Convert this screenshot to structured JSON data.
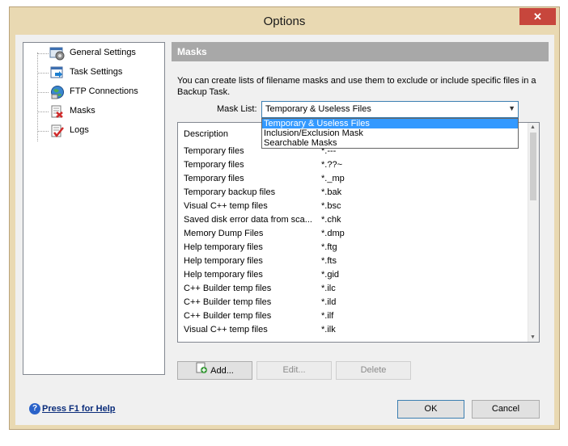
{
  "window": {
    "title": "Options",
    "close_label": "✕"
  },
  "tree": {
    "items": [
      {
        "label": "General Settings",
        "icon": "gear-icon"
      },
      {
        "label": "Task Settings",
        "icon": "task-icon"
      },
      {
        "label": "FTP Connections",
        "icon": "globe-icon"
      },
      {
        "label": "Masks",
        "icon": "masks-icon"
      },
      {
        "label": "Logs",
        "icon": "logs-icon"
      }
    ]
  },
  "panel": {
    "header": "Masks",
    "description": "You can create lists of filename masks and use them to exclude or include specific files in a Backup Task.",
    "mask_list_label": "Mask List:",
    "mask_list_value": "Temporary & Useless Files",
    "dropdown_options": [
      "Temporary & Useless Files",
      "Inclusion/Exclusion Mask",
      "Searchable Masks"
    ],
    "columns": {
      "description": "Description",
      "mask": ""
    },
    "rows": [
      {
        "description": "Temporary files",
        "mask": "*.---"
      },
      {
        "description": "Temporary files",
        "mask": "*.??~"
      },
      {
        "description": "Temporary files",
        "mask": "*._mp"
      },
      {
        "description": "Temporary backup files",
        "mask": "*.bak"
      },
      {
        "description": "Visual C++ temp files",
        "mask": "*.bsc"
      },
      {
        "description": "Saved disk error data from sca...",
        "mask": "*.chk"
      },
      {
        "description": "Memory Dump Files",
        "mask": "*.dmp"
      },
      {
        "description": "Help temporary files",
        "mask": "*.ftg"
      },
      {
        "description": "Help temporary files",
        "mask": "*.fts"
      },
      {
        "description": "Help temporary files",
        "mask": "*.gid"
      },
      {
        "description": "C++ Builder temp files",
        "mask": "*.ilc"
      },
      {
        "description": "C++ Builder temp files",
        "mask": "*.ild"
      },
      {
        "description": "C++ Builder temp files",
        "mask": "*.ilf"
      },
      {
        "description": "Visual C++ temp files",
        "mask": "*.ilk"
      }
    ],
    "buttons": {
      "add": "Add...",
      "edit": "Edit...",
      "delete": "Delete"
    }
  },
  "footer": {
    "help_label": "Press F1 for Help",
    "ok": "OK",
    "cancel": "Cancel"
  },
  "colors": {
    "frame": "#e9d9b2",
    "close": "#c7463c",
    "header": "#a8a8a8",
    "selection": "#3399ff",
    "link": "#0a2c7a"
  }
}
